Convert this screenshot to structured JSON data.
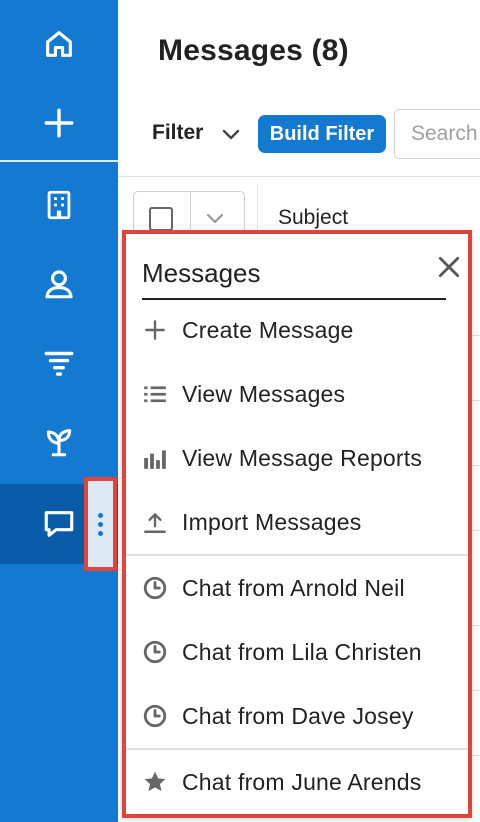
{
  "page": {
    "title": "Messages (8)",
    "filter_label": "Filter",
    "build_filter_label": "Build Filter",
    "search_placeholder": "Search"
  },
  "list": {
    "column_subject": "Subject"
  },
  "sidebar": {
    "items": [
      {
        "name": "home-icon"
      },
      {
        "name": "plus-icon"
      },
      {
        "name": "building-icon"
      },
      {
        "name": "user-icon"
      },
      {
        "name": "funnel-icon"
      },
      {
        "name": "sprout-icon"
      },
      {
        "name": "chat-icon",
        "active": true
      }
    ],
    "accent": "#1479d0",
    "active_bg": "#0a5ba8"
  },
  "popup": {
    "title": "Messages",
    "items": [
      {
        "label": "Create Message",
        "icon": "plus-icon"
      },
      {
        "label": "View Messages",
        "icon": "list-icon"
      },
      {
        "label": "View Message Reports",
        "icon": "bar-chart-icon"
      },
      {
        "label": "Import Messages",
        "icon": "upload-icon"
      },
      {
        "label": "Chat from Arnold Neil",
        "icon": "clock-icon"
      },
      {
        "label": "Chat from Lila Christen",
        "icon": "clock-icon"
      },
      {
        "label": "Chat from Dave Josey",
        "icon": "clock-icon"
      },
      {
        "label": "Chat from June Arends",
        "icon": "star-icon"
      }
    ],
    "highlight_color": "#e0443a"
  }
}
